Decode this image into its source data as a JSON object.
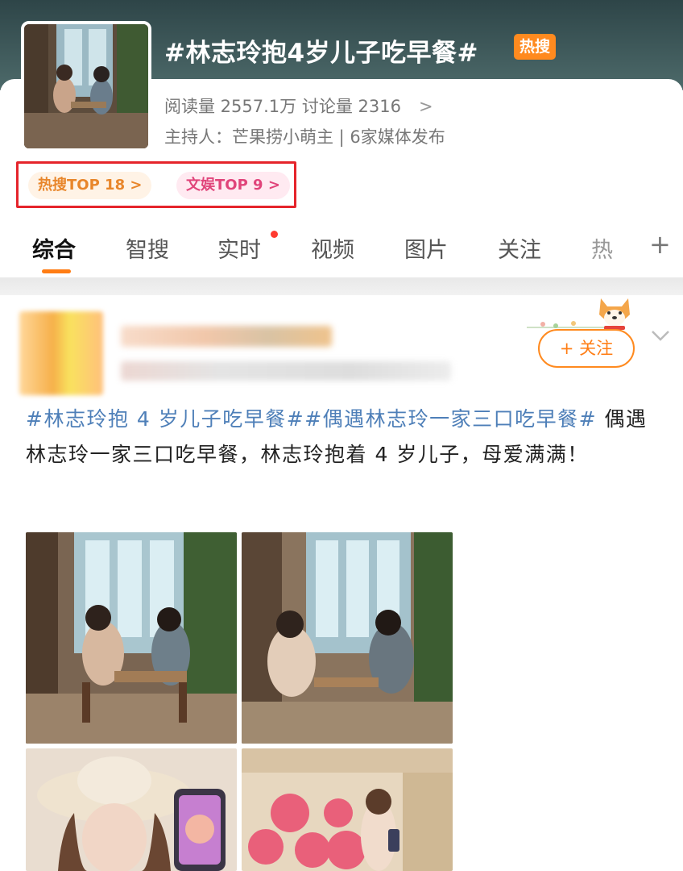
{
  "topic": {
    "title": "#林志玲抱4岁儿子吃早餐#",
    "badge": "热搜",
    "stats": "阅读量 2557.1万   讨论量 2316",
    "stats_chevron": ">",
    "host": "主持人：芒果捞小萌主 | 6家媒体发布",
    "rank_hot": "热搜TOP 18 >",
    "rank_ent": "文娱TOP 9 >"
  },
  "tabs": {
    "items": [
      {
        "label": "综合"
      },
      {
        "label": "智搜"
      },
      {
        "label": "实时"
      },
      {
        "label": "视频"
      },
      {
        "label": "图片"
      },
      {
        "label": "关注"
      },
      {
        "label": "热"
      }
    ],
    "plus": "+"
  },
  "post": {
    "follow_label": "+ 关注",
    "hashtag1": "#林志玲抱 4 岁儿子吃早餐#",
    "hashtag2": "#偶遇林志玲一家三口吃早餐#",
    "body": " 偶遇林志玲一家三口吃早餐，林志玲抱着 4 岁儿子，母爱满满！"
  },
  "colors": {
    "accent": "#ff7d14",
    "hashtag": "#4e7fb8",
    "highlight_box": "#e5242b"
  }
}
